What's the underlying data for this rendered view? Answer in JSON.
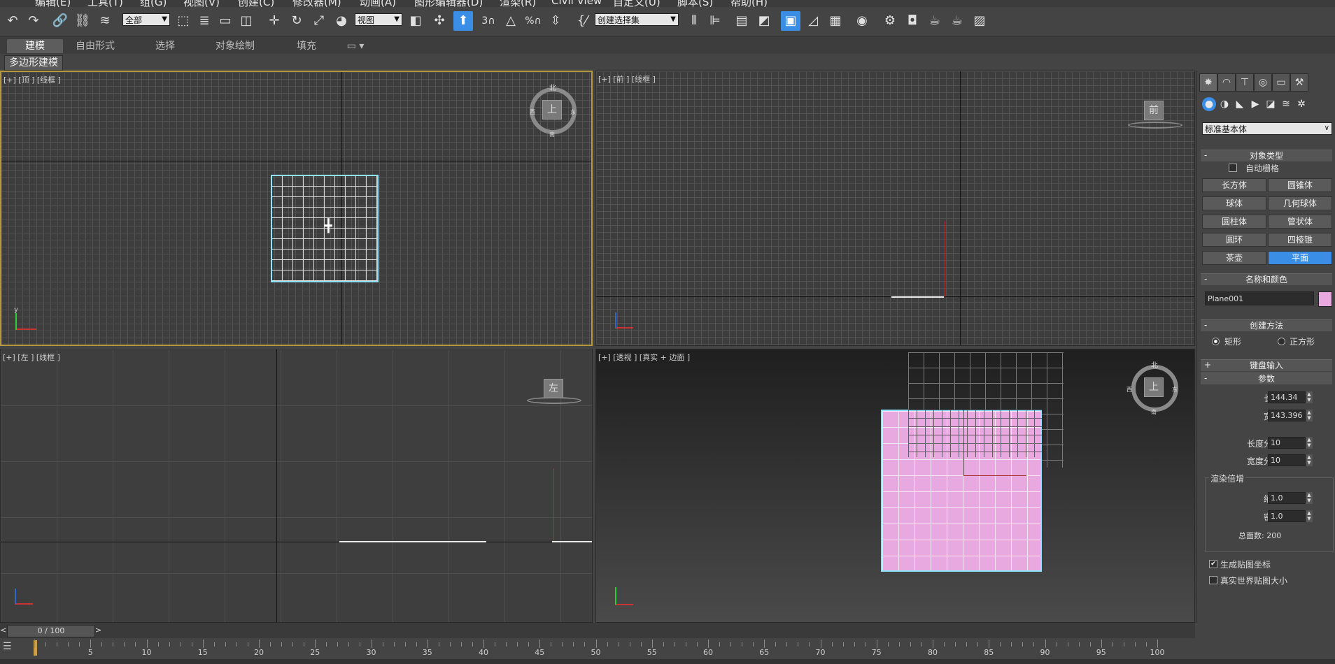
{
  "menu": [
    "编辑(E)",
    "工具(T)",
    "组(G)",
    "视图(V)",
    "创建(C)",
    "修改器(M)",
    "动画(A)",
    "图形编辑器(D)",
    "渲染(R)",
    "Civil View",
    "自定义(U)",
    "脚本(S)",
    "帮助(H)"
  ],
  "toolbar": {
    "selection_filter": "全部",
    "ref_coord": "视图",
    "named_selection": "创建选择集",
    "snap_label": "3",
    "percent_label": "%"
  },
  "ribbon": {
    "tabs": [
      "建模",
      "自由形式",
      "选择",
      "对象绘制",
      "填充"
    ],
    "active_index": 0,
    "subtab": "多边形建模"
  },
  "viewports": {
    "top": {
      "label": "[+] [顶 ] [线框 ]",
      "cube": "上",
      "compass": {
        "n": "北",
        "s": "南",
        "e": "东",
        "w": "西"
      }
    },
    "front": {
      "label": "[+] [前 ] [线框 ]",
      "cube": "前"
    },
    "left": {
      "label": "[+] [左 ] [线框 ]",
      "cube": "左"
    },
    "persp": {
      "label": "[+] [透视 ] [真实 + 边面 ]",
      "cube": "上",
      "compass": {
        "n": "北",
        "s": "南",
        "e": "东",
        "w": "西"
      }
    },
    "axis": {
      "x": "x",
      "y": "y",
      "z": "z"
    }
  },
  "panel": {
    "primitive_type": "标准基本体",
    "object_type_title": "对象类型",
    "autogrid_label": "自动栅格",
    "autogrid_checked": false,
    "buttons": [
      "长方体",
      "圆锥体",
      "球体",
      "几何球体",
      "圆柱体",
      "管状体",
      "圆环",
      "四棱锥",
      "茶壶",
      "平面"
    ],
    "active_button": "平面",
    "name_color_title": "名称和颜色",
    "object_name": "Plane001",
    "object_color": "#e8a8e0",
    "creation_method_title": "创建方法",
    "creation_options": [
      "矩形",
      "正方形"
    ],
    "creation_selected": "矩形",
    "keyboard_input_title": "键盘输入",
    "params_title": "参数",
    "length_label": "长度:",
    "length_value": "144.34",
    "width_label": "宽度:",
    "width_value": "143.396",
    "length_segs_label": "长度分段:",
    "length_segs_value": "10",
    "width_segs_label": "宽度分段:",
    "width_segs_value": "10",
    "render_mult_title": "渲染倍增",
    "scale_label": "缩放:",
    "scale_value": "1.0",
    "density_label": "密度:",
    "density_value": "1.0",
    "total_faces": "总面数: 200",
    "gen_map_label": "生成贴图坐标",
    "gen_map_checked": true,
    "real_world_label": "真实世界贴图大小",
    "real_world_checked": false
  },
  "timeline": {
    "frame_counter": "0 / 100",
    "prev_arrow": "<",
    "next_arrow": ">",
    "ticks": [
      "5",
      "10",
      "15",
      "20",
      "25",
      "30",
      "35",
      "40",
      "45",
      "50",
      "55",
      "60",
      "65",
      "70",
      "75",
      "80",
      "85",
      "90",
      "95",
      "100"
    ]
  },
  "colors": {
    "accent": "#3a8ee6",
    "selection": "#8fe3ff",
    "plane": "#e8a8e0",
    "active_border": "#b39a3c"
  }
}
